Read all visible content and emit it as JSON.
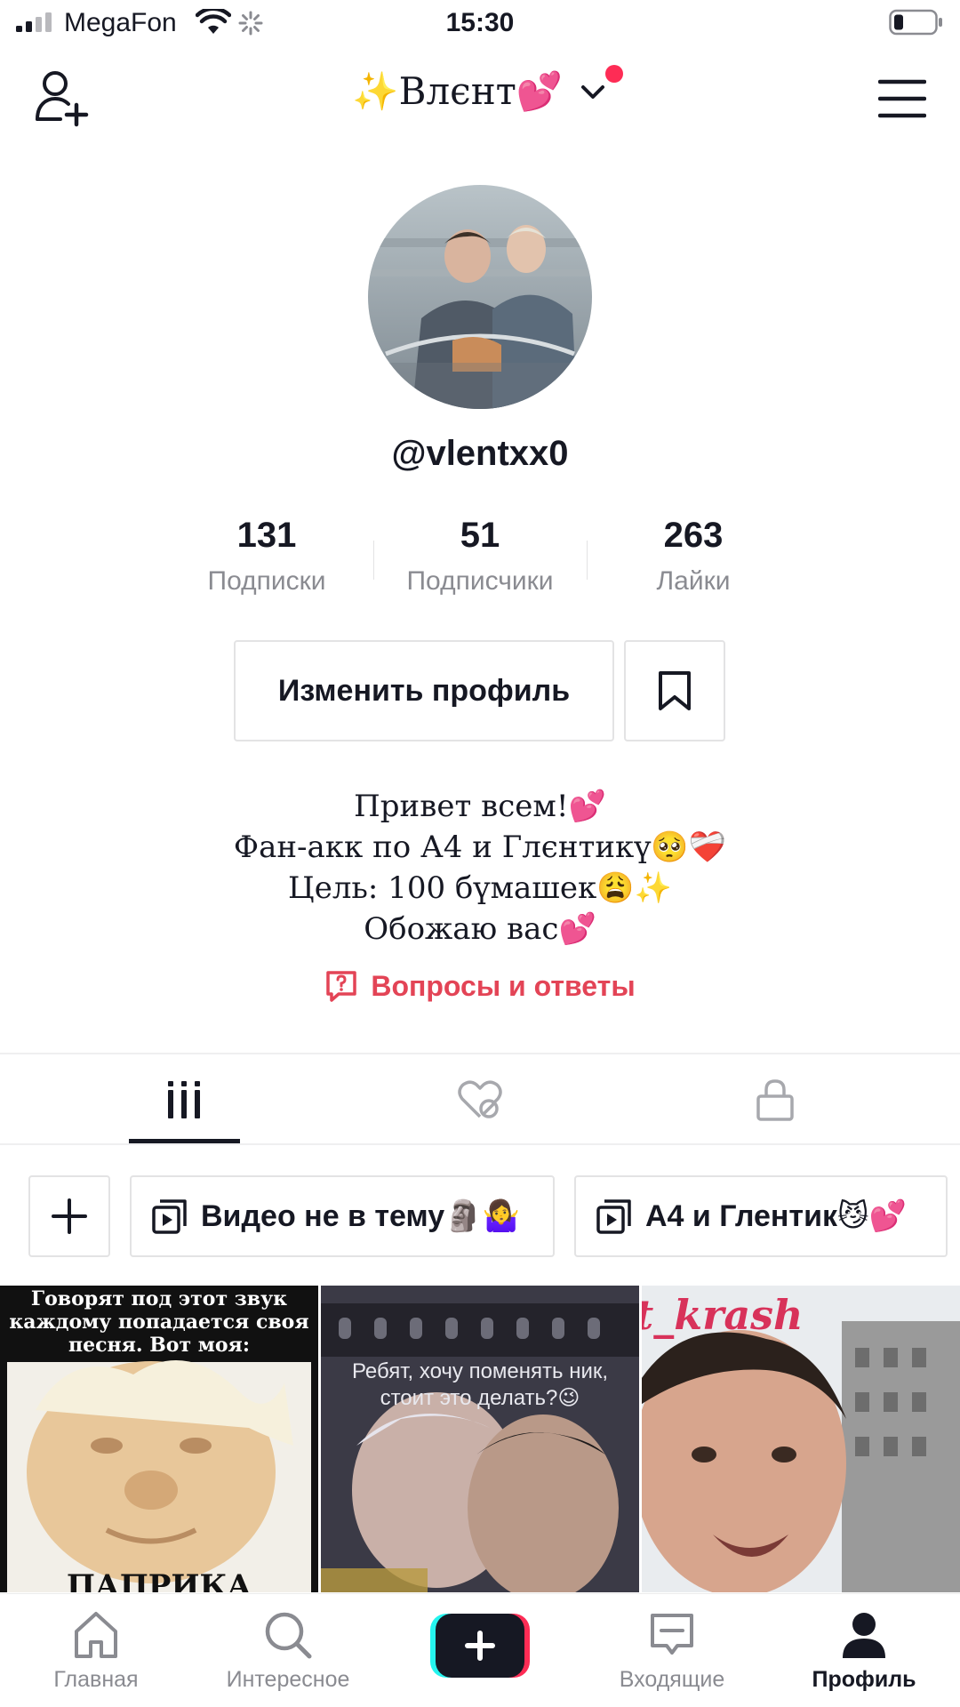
{
  "status_bar": {
    "carrier": "MegaFon",
    "time": "15:30"
  },
  "header": {
    "title": "✨Влєнт💕",
    "add_user_icon": "add-user-icon",
    "dropdown_icon": "chevron-down-icon",
    "menu_icon": "hamburger-menu-icon"
  },
  "profile": {
    "username": "@vlentxx0",
    "stats": [
      {
        "value": "131",
        "label": "Подписки"
      },
      {
        "value": "51",
        "label": "Подписчики"
      },
      {
        "value": "263",
        "label": "Лайки"
      }
    ],
    "edit_button": "Изменить профиль",
    "bio": [
      "Привет всем!💕",
      "Фан-акк по А4 и Глєнтикү🥺❤️‍🩹",
      "Цель: 100 бүмашек😩✨",
      "Обожаю вас💕"
    ],
    "qa_link": "Вопросы и ответы"
  },
  "tabs": [
    {
      "icon": "grid-icon",
      "active": true
    },
    {
      "icon": "liked-hidden-icon",
      "active": false
    },
    {
      "icon": "lock-icon",
      "active": false
    }
  ],
  "playlists": [
    {
      "label": "Видео не в тему🗿🤷‍♀️"
    },
    {
      "label": "А4 и Глентик😼💕"
    }
  ],
  "videos": [
    {
      "caption": "Говорят под этот звук каждому попадается своя песня. Вот моя:",
      "bottom_text": "ПАПРИКА"
    },
    {
      "caption": "Ребят, хочу поменять ник, стоит это делать?😉"
    },
    {
      "caption": "t_krash"
    }
  ],
  "bottom_nav": [
    {
      "label": "Главная",
      "icon": "home-icon",
      "active": false
    },
    {
      "label": "Интересное",
      "icon": "search-icon",
      "active": false
    },
    {
      "label": "",
      "icon": "plus-icon",
      "active": false
    },
    {
      "label": "Входящие",
      "icon": "inbox-icon",
      "active": false
    },
    {
      "label": "Профиль",
      "icon": "profile-icon",
      "active": true
    }
  ],
  "colors": {
    "accent_red": "#fe2c55",
    "qa_red": "#e34456",
    "text_primary": "#161823",
    "text_secondary": "#8a8b91",
    "border": "#e3e3e4"
  }
}
